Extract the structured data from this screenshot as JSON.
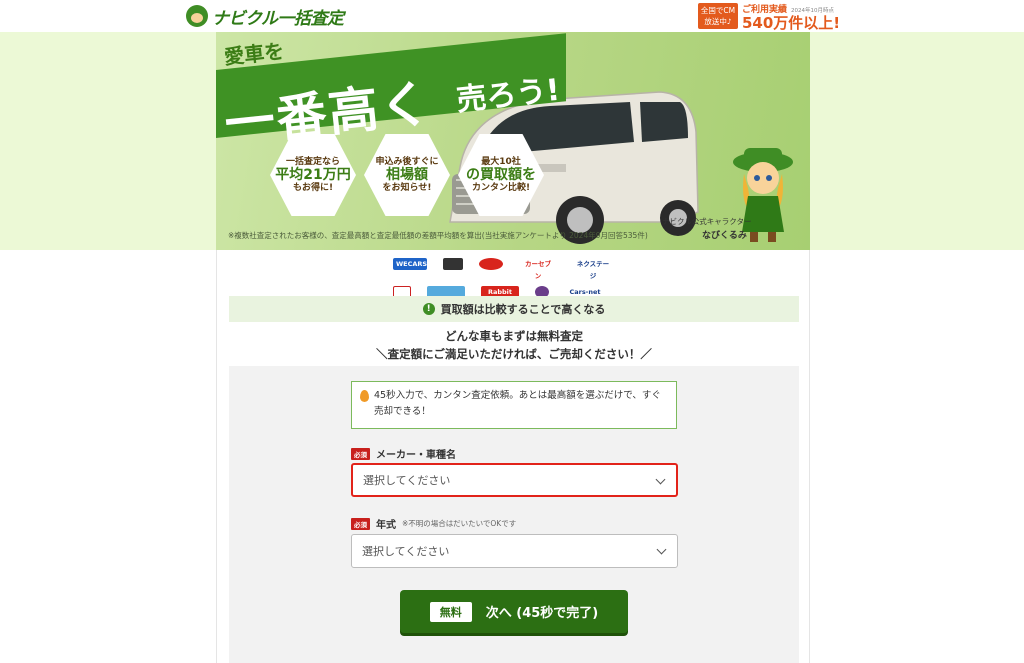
{
  "header": {
    "logo_text": "ナビクル一括査定",
    "cm_badge": "全国でCM放送中♪",
    "results_label": "ご利用実績",
    "results_note": "2024年10月時点",
    "results_value": "540万件以上!"
  },
  "hero": {
    "tagline_small": "愛車を",
    "tagline_big": "一番高く",
    "tagline_sell": "売ろう!",
    "hex1": {
      "line1": "一括査定なら",
      "line2": "平均21万円",
      "line3": "もお得に!"
    },
    "hex2": {
      "line1": "申込み後すぐに",
      "line2": "相場額",
      "line3": "をお知らせ!"
    },
    "hex3": {
      "line1": "最大10社",
      "line2": "の買取額を",
      "line3": "カンタン比較!"
    },
    "disclaimer": "※複数社査定されたお客様の、査定最高額と査定最低額の差額平均額を算出(当社実施アンケートより 2024年9月回答535件)",
    "character_caption": "ナビクル公式キャラクター",
    "character_name": "なびくるみ",
    "colors": {
      "accent": "#3f8d25",
      "band": "#ecf9d6"
    }
  },
  "partners": [
    "WECARS",
    "",
    "",
    "カーセブン",
    "ネクステージ",
    "",
    "",
    "Rabbit",
    "",
    "Cars-net"
  ],
  "notice": "買取額は比較することで高くなる",
  "lead1": "どんな車もまずは無料査定",
  "lead2": "＼査定額にご満足いただければ、ご売却ください！／",
  "tip": "45秒入力で、カンタン査定依頼。あとは最高額を選ぶだけで、すぐ売却できる！",
  "fields": {
    "maker": {
      "required": "必須",
      "label": "メーカー・車種名",
      "placeholder": "選択してください"
    },
    "year": {
      "required": "必須",
      "label": "年式",
      "note": "※不明の場合はだいたいでOKです",
      "placeholder": "選択してください"
    }
  },
  "next_button": {
    "free": "無料",
    "label": "次へ (45秒で完了)"
  }
}
